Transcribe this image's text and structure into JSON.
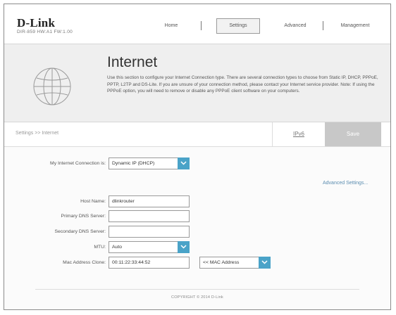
{
  "brand": {
    "logo": "D-Link",
    "model": "DIR-859 HW:A1 FW:1.00"
  },
  "nav": {
    "home": "Home",
    "settings": "Settings",
    "advanced": "Advanced",
    "management": "Management"
  },
  "banner": {
    "title": "Internet",
    "description": "Use this section to configure your Internet Connection type. There are several connection types to choose from Static IP, DHCP, PPPoE, PPTP, L2TP and DS-Lite. If you are unsure of your connection method, please contact your Internet service provider. Note: If using the PPPoE option, you will need to remove or disable any PPPoE client software on your computers."
  },
  "breadcrumb": "Settings >> Internet",
  "tabs": {
    "ipv6": "IPv6",
    "save": "Save"
  },
  "form": {
    "connection_label": "My Internet Connection is:",
    "connection_value": "Dynamic IP (DHCP)",
    "advanced_link": "Advanced Settings...",
    "host_name_label": "Host Name:",
    "host_name_value": "dlinkrouter",
    "primary_dns_label": "Primary DNS Server:",
    "primary_dns_value": "",
    "secondary_dns_label": "Secondary DNS Server:",
    "secondary_dns_value": "",
    "mtu_label": "MTU:",
    "mtu_value": "Auto",
    "mac_clone_label": "Mac Address Clone:",
    "mac_clone_value": "00:11:22:33:44:52",
    "mac_select_value": "<< MAC Address"
  },
  "footer": {
    "copyright": "COPYRIGHT © 2014 D-Link"
  },
  "colors": {
    "accent": "#4aa3c8",
    "link": "#5b8db0",
    "banner_bg": "#efefef",
    "save_bg": "#c8c8c8"
  }
}
